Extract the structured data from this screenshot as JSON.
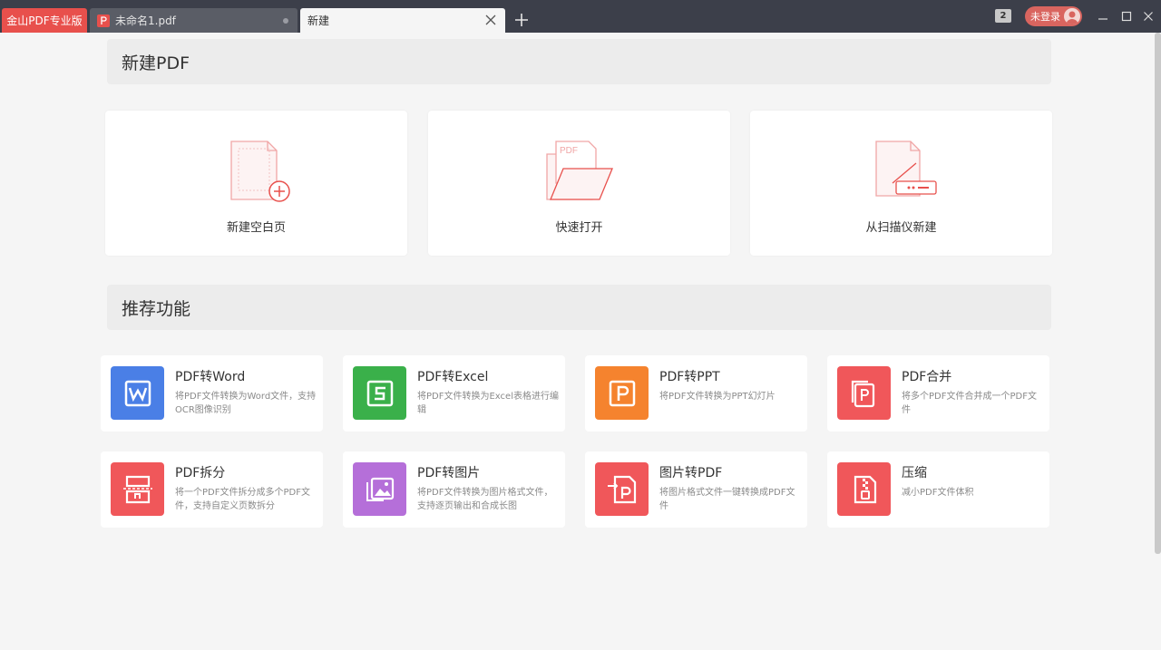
{
  "titlebar": {
    "app_tab": "金山PDF专业版",
    "doc_tab": "未命名1.pdf",
    "new_tab": "新建",
    "tab_count": "2",
    "login": "未登录"
  },
  "sections": {
    "new_pdf": "新建PDF",
    "recommended": "推荐功能"
  },
  "create_cards": [
    {
      "label": "新建空白页",
      "icon": "blank-page-plus-icon"
    },
    {
      "label": "快速打开",
      "icon": "folder-open-icon"
    },
    {
      "label": "从扫描仪新建",
      "icon": "scanner-icon"
    }
  ],
  "pdf_icon_text": "PDF",
  "features": [
    {
      "title": "PDF转Word",
      "desc": "将PDF文件转换为Word文件，支持OCR图像识别",
      "color": "#4a7fe6"
    },
    {
      "title": "PDF转Excel",
      "desc": "将PDF文件转换为Excel表格进行编辑",
      "color": "#3ab04a"
    },
    {
      "title": "PDF转PPT",
      "desc": "将PDF文件转换为PPT幻灯片",
      "color": "#f5832e"
    },
    {
      "title": "PDF合并",
      "desc": "将多个PDF文件合并成一个PDF文件",
      "color": "#f0575a"
    },
    {
      "title": "PDF拆分",
      "desc": "将一个PDF文件拆分成多个PDF文件，支持自定义页数拆分",
      "color": "#f0575a"
    },
    {
      "title": "PDF转图片",
      "desc": "将PDF文件转换为图片格式文件，支持逐页输出和合成长图",
      "color": "#b56fd9"
    },
    {
      "title": "图片转PDF",
      "desc": "将图片格式文件一键转换成PDF文件",
      "color": "#f0575a"
    },
    {
      "title": "压缩",
      "desc": "减小PDF文件体积",
      "color": "#f0575a"
    }
  ]
}
